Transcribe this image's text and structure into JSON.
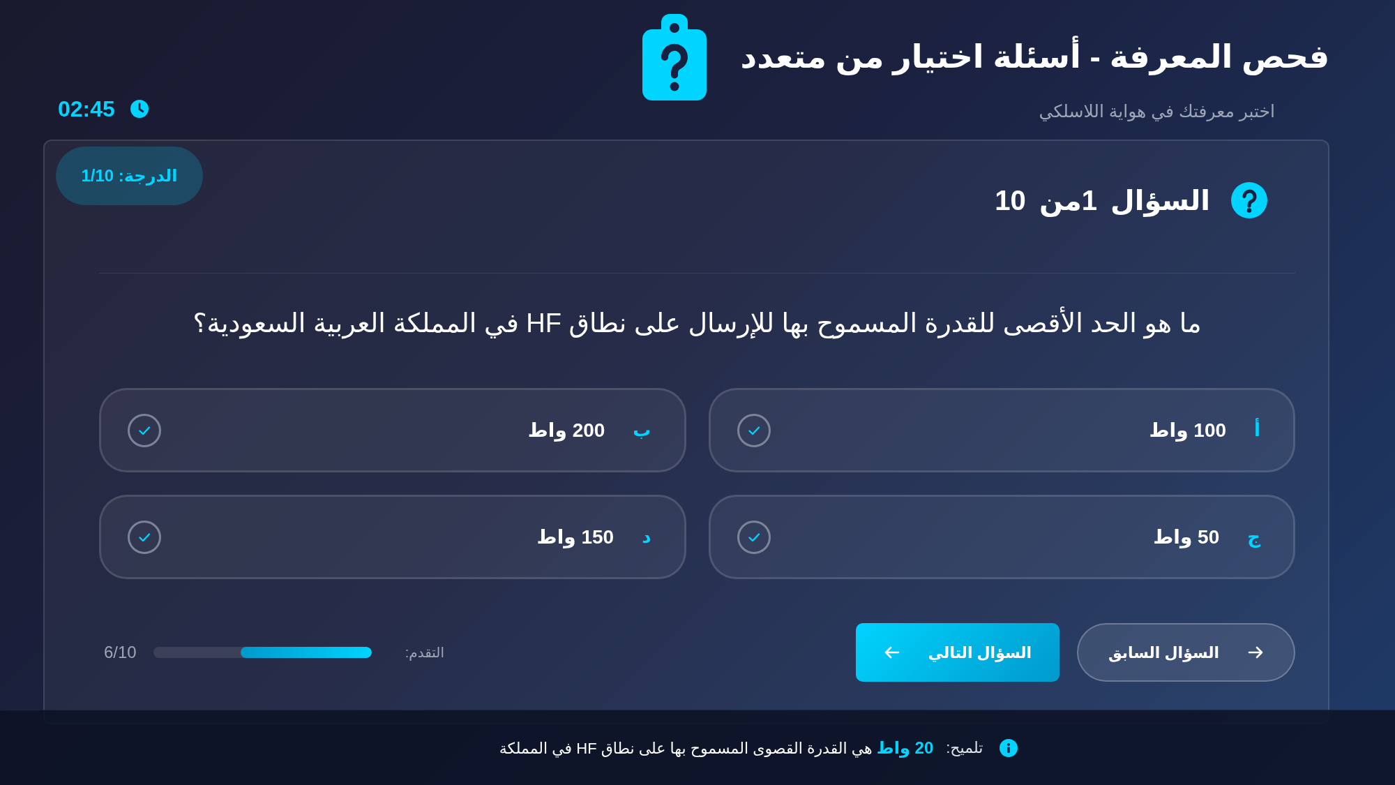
{
  "header": {
    "title": "فحص المعرفة - أسئلة اختيار من متعدد",
    "subtitle": "اختبر معرفتك في هواية اللاسلكي"
  },
  "timer": "02:45",
  "score": "الدرجة: 1/10",
  "question": {
    "counter": "السؤال 1من 10",
    "text": "ما هو الحد الأقصى للقدرة المسموح بها للإرسال على نطاق HF في المملكة العربية السعودية؟"
  },
  "options": [
    {
      "letter": "أ",
      "text": "100 واط",
      "selected": false
    },
    {
      "letter": "ب",
      "text": "200 واط",
      "selected": false
    },
    {
      "letter": "ج",
      "text": "50 واط",
      "selected": false
    },
    {
      "letter": "د",
      "text": "150 واط",
      "selected": false
    }
  ],
  "navigation": {
    "previous": "السؤال السابق",
    "next": "السؤال التالي"
  },
  "progress": {
    "label": "التقدم:",
    "level": 0.6,
    "count": "6/10"
  },
  "hint": {
    "label": "تلميح:",
    "text": "**20 واط** هي القدرة القصوى المسموح بها على نطاق HF في المملكة"
  }
}
